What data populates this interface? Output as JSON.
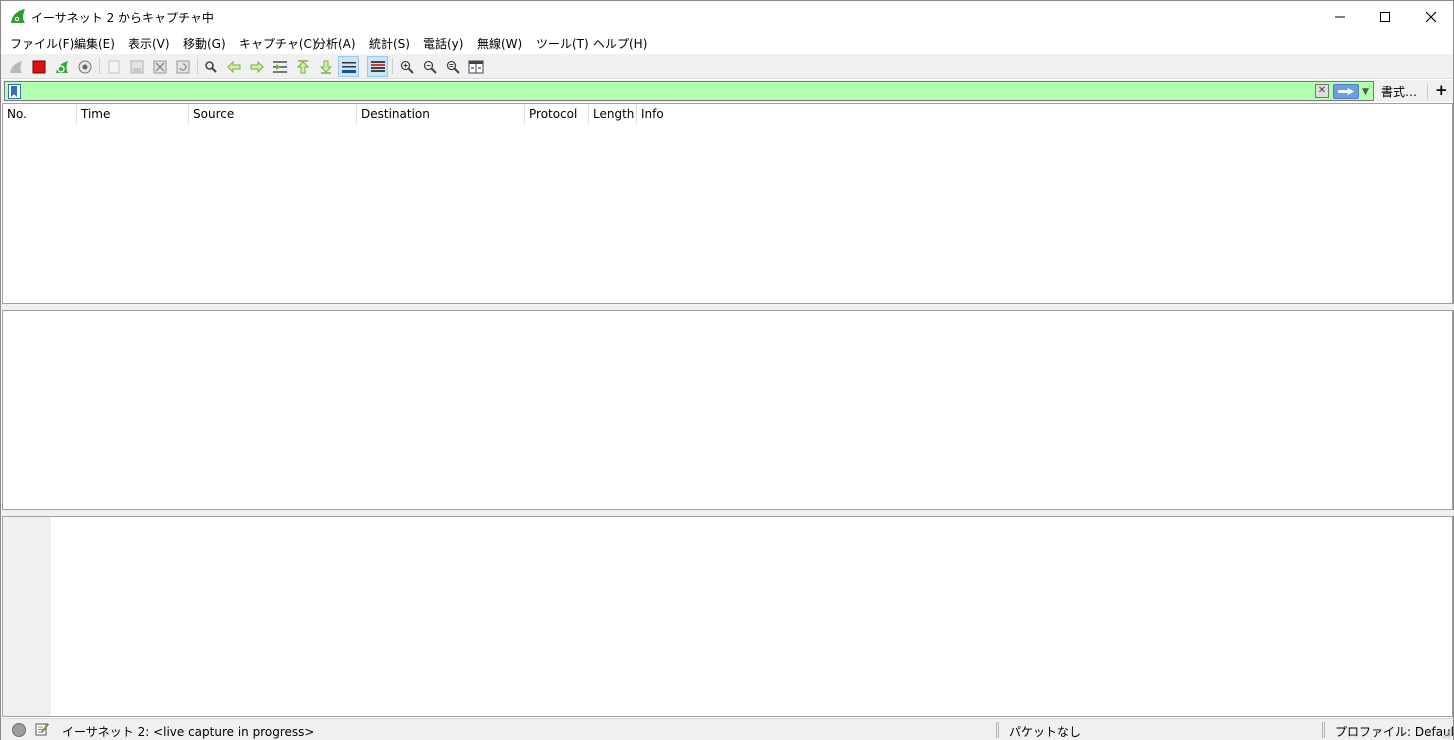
{
  "window": {
    "title": "イーサネット 2 からキャプチャ中",
    "icon": "wireshark-fin-icon",
    "controls": [
      "minimize-icon",
      "maximize-icon",
      "close-icon"
    ]
  },
  "menu": {
    "items": [
      {
        "label": "ファイル(F)"
      },
      {
        "label": "編集(E)"
      },
      {
        "label": "表示(V)"
      },
      {
        "label": "移動(G)"
      },
      {
        "label": "キャプチャ(C)"
      },
      {
        "label": "分析(A)"
      },
      {
        "label": "統計(S)"
      },
      {
        "label": "電話(y)"
      },
      {
        "label": "無線(W)"
      },
      {
        "label": "ツール(T)"
      },
      {
        "label": "ヘルプ(H)"
      }
    ]
  },
  "toolbar": {
    "buttons": [
      "start-capture-icon",
      "stop-capture-icon",
      "restart-capture-icon",
      "capture-options-icon",
      "open-file-icon",
      "save-file-icon",
      "close-file-icon",
      "reload-file-icon",
      "find-packet-icon",
      "go-back-icon",
      "go-forward-icon",
      "go-to-packet-icon",
      "go-first-icon",
      "go-last-icon",
      "auto-scroll-icon",
      "colorize-icon",
      "zoom-in-icon",
      "zoom-out-icon",
      "zoom-normal-icon",
      "resize-columns-icon"
    ],
    "active": [
      "auto-scroll-icon",
      "colorize-icon"
    ]
  },
  "filter": {
    "value": "",
    "background_color": "#afffaf",
    "format_label": "書式…",
    "add_label": "+"
  },
  "packet_list": {
    "columns": [
      "No.",
      "Time",
      "Source",
      "Destination",
      "Protocol",
      "Length",
      "Info"
    ],
    "rows": []
  },
  "status": {
    "interface_text": "イーサネット 2: <live capture in progress>",
    "packets_text": "パケットなし",
    "profile_text": "プロファイル: Default"
  }
}
